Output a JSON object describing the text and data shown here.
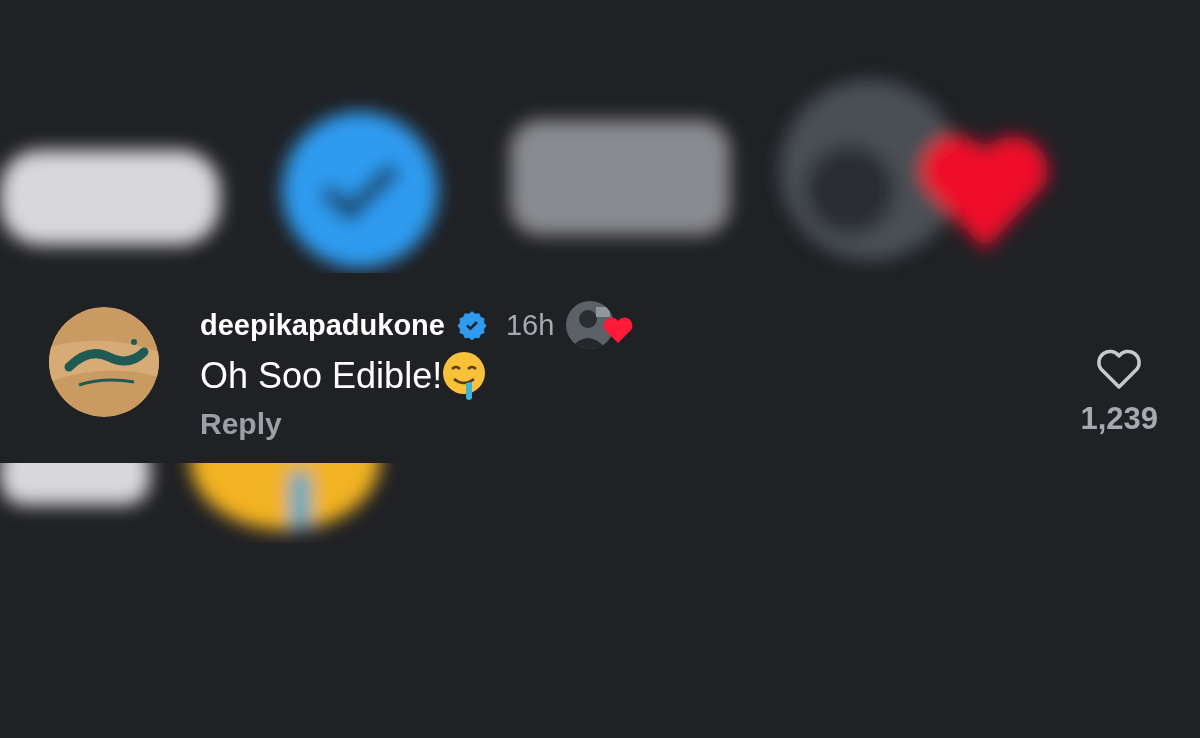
{
  "comment": {
    "username": "deepikapadukone",
    "verified": true,
    "time": "16h",
    "creator_liked": true,
    "text": "Oh Soo Edible!",
    "reply": "Reply",
    "liked": false,
    "like_count": "1,239"
  }
}
